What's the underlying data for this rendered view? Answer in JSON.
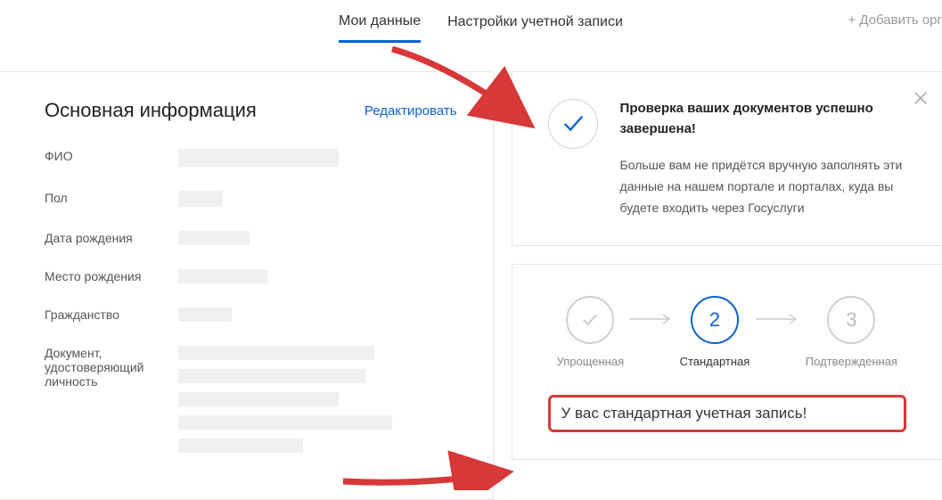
{
  "tabs": {
    "my_data": "Мои данные",
    "account_settings": "Настройки учетной записи",
    "add_org": "+ Добавить орг"
  },
  "main_info": {
    "title": "Основная информация",
    "edit": "Редактировать",
    "fields": {
      "fio": "ФИО",
      "gender": "Пол",
      "dob": "Дата рождения",
      "birthplace": "Место рождения",
      "citizenship": "Гражданство",
      "id_doc": "Документ, удостоверяющий личность"
    }
  },
  "notification": {
    "title": "Проверка ваших документов успешно завершена!",
    "desc": "Больше вам не придётся вручную заполнять эти данные на нашем портале и порталах, куда вы будете входить через Госуслуги"
  },
  "account_level": {
    "steps": {
      "s1": "Упрощенная",
      "s2": "Стандартная",
      "s3": "Подтвержденная",
      "n2": "2",
      "n3": "3"
    },
    "status": "У вас стандартная учетная запись!"
  }
}
